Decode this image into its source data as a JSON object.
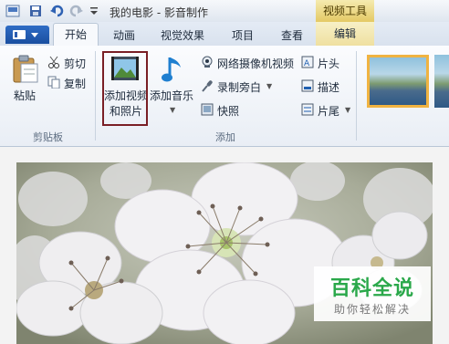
{
  "window": {
    "title": "我的电影 - 影音制作",
    "context_tab_group": "视频工具"
  },
  "tabs": {
    "file_menu": "",
    "items": [
      "开始",
      "动画",
      "视觉效果",
      "项目",
      "查看"
    ],
    "context_tab": "编辑"
  },
  "ribbon": {
    "clipboard": {
      "paste": "粘贴",
      "cut": "剪切",
      "copy": "复制",
      "group_label": "剪贴板"
    },
    "add": {
      "add_videos_photos_line1": "添加视频",
      "add_videos_photos_line2": "和照片",
      "add_music": "添加音乐",
      "webcam_video": "网络摄像机视频",
      "record_narration": "录制旁白",
      "snapshot": "快照",
      "title": "片头",
      "caption": "描述",
      "credits": "片尾",
      "group_label": "添加"
    }
  },
  "watermark": {
    "main": "百科全说",
    "sub": "助你轻松解决"
  },
  "colors": {
    "highlight_box": "#7a1f25",
    "context_tab": "#e4c964",
    "watermark_green": "#2aa84a"
  }
}
